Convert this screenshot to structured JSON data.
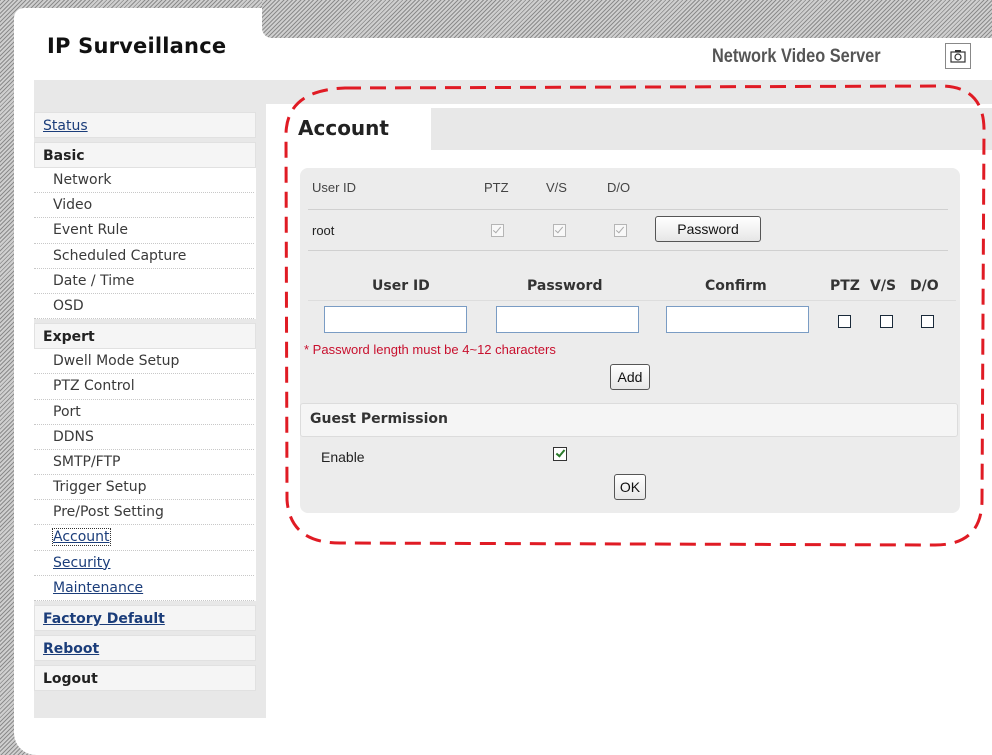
{
  "header": {
    "brand": "IP Surveillance",
    "product": "Network Video Server"
  },
  "sidebar": {
    "status": "Status",
    "basic": {
      "title": "Basic",
      "items": [
        "Network",
        "Video",
        "Event Rule",
        "Scheduled Capture",
        "Date / Time",
        "OSD"
      ]
    },
    "expert": {
      "title": "Expert",
      "items": [
        "Dwell Mode Setup",
        "PTZ Control",
        "Port",
        "DDNS",
        "SMTP/FTP",
        "Trigger Setup",
        "Pre/Post Setting",
        "Account",
        "Security",
        "Maintenance"
      ]
    },
    "factory_default": "Factory Default",
    "reboot": "Reboot",
    "logout": "Logout"
  },
  "page": {
    "title": "Account"
  },
  "accounts_table": {
    "headers": [
      "User ID",
      "PTZ",
      "V/S",
      "D/O"
    ],
    "rows": [
      {
        "user": "root",
        "ptz": true,
        "vs": true,
        "do": true
      }
    ],
    "password_button": "Password"
  },
  "add_form": {
    "headers": {
      "user_id": "User ID",
      "password": "Password",
      "confirm": "Confirm",
      "ptz": "PTZ",
      "vs": "V/S",
      "do": "D/O"
    },
    "user_id_value": "",
    "password_value": "",
    "confirm_value": "",
    "warning": "* Password length must be 4~12 characters",
    "add_button": "Add"
  },
  "guest": {
    "title": "Guest Permission",
    "enable_label": "Enable",
    "enabled": true,
    "ok_button": "OK"
  },
  "colors": {
    "link": "#1b3d7a",
    "warning": "#c8102e",
    "highlight_dash": "#e01b24"
  }
}
